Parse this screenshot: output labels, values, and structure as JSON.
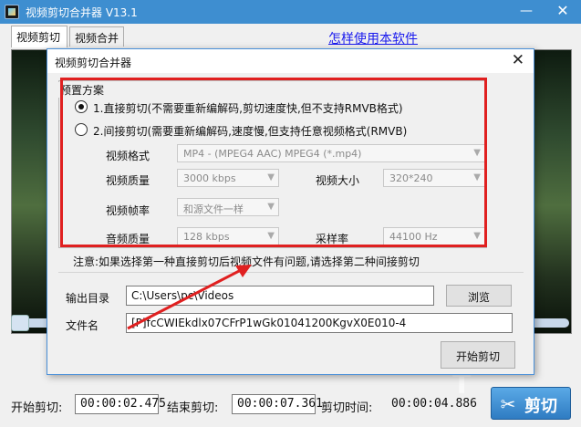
{
  "window": {
    "title": "视频剪切合并器 V13.1",
    "minimize": "—",
    "close": "✕"
  },
  "tabs": [
    {
      "label": "视频剪切"
    },
    {
      "label": "视频合并"
    }
  ],
  "help_link": "怎样使用本软件",
  "timeline": {
    "position": 0.0
  },
  "bottom": {
    "start_label": "开始剪切:",
    "start_value": "00:00:02.475",
    "end_label": "结束剪切:",
    "end_value": "00:00:07.361",
    "duration_label": "剪切时间:",
    "duration_value": "00:00:04.886",
    "cut_button": "剪切",
    "cut_icon": "scissors-icon"
  },
  "dialog": {
    "title": "视频剪切合并器",
    "close": "✕",
    "group_title": "预置方案",
    "option1": "1.直接剪切(不需要重新编解码,剪切速度快,但不支持RMVB格式)",
    "option2": "2.间接剪切(需要重新编解码,速度慢,但支持任意视频格式(RMVB)",
    "selected_option": 1,
    "format_label": "视频格式",
    "format_value": "MP4 - (MPEG4 AAC) MPEG4 (*.mp4)",
    "quality_label": "视频质量",
    "quality_value": "3000 kbps",
    "size_label": "视频大小",
    "size_value": "320*240",
    "fps_label": "视频帧率",
    "fps_value": "和源文件一样",
    "audio_label": "音频质量",
    "audio_value": "128 kbps",
    "samplerate_label": "采样率",
    "samplerate_value": "44100 Hz",
    "note": "注意:如果选择第一种直接剪切后视频文件有问题,请选择第二种间接剪切",
    "output_label": "输出目录",
    "output_value": "C:\\Users\\pc\\Videos",
    "browse_button": "浏览",
    "filename_label": "文件名",
    "filename_value": "[P]fcCWIEkdlx07CFrP1wGk01041200KgvX0E010-4",
    "start_button": "开始剪切"
  },
  "colors": {
    "titlebar": "#3e8ed0",
    "highlight": "#e02020",
    "link": "#1a1aee"
  }
}
